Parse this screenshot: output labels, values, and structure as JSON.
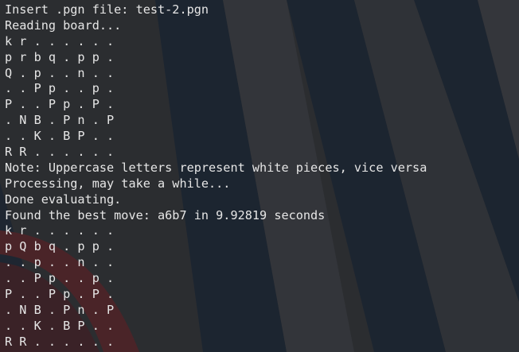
{
  "terminal": {
    "lines": [
      "Insert .pgn file: test-2.pgn",
      "Reading board...",
      "k r . . . . . .",
      "p r b q . p p .",
      "Q . p . . n . .",
      ". . P p . . p .",
      "P . . P p . P .",
      ". N B . P n . P",
      ". . K . B P . .",
      "R R . . . . . .",
      "Note: Uppercase letters represent white pieces, vice versa",
      "Processing, may take a while...",
      "Done evaluating.",
      "Found the best move: a6b7 in 9.92819 seconds",
      "k r . . . . . .",
      "p Q b q . p p .",
      ". . p . . n . .",
      ". . P p . . p .",
      "P . . P p . P .",
      ". N B . P n . P",
      ". . K . B P . .",
      "R R . . . . . ."
    ]
  },
  "colors": {
    "text": "#e6e6e6",
    "background": "#2a2d31",
    "stripe_dark": "#1c2530",
    "accent_red": "#5e2a2e"
  }
}
